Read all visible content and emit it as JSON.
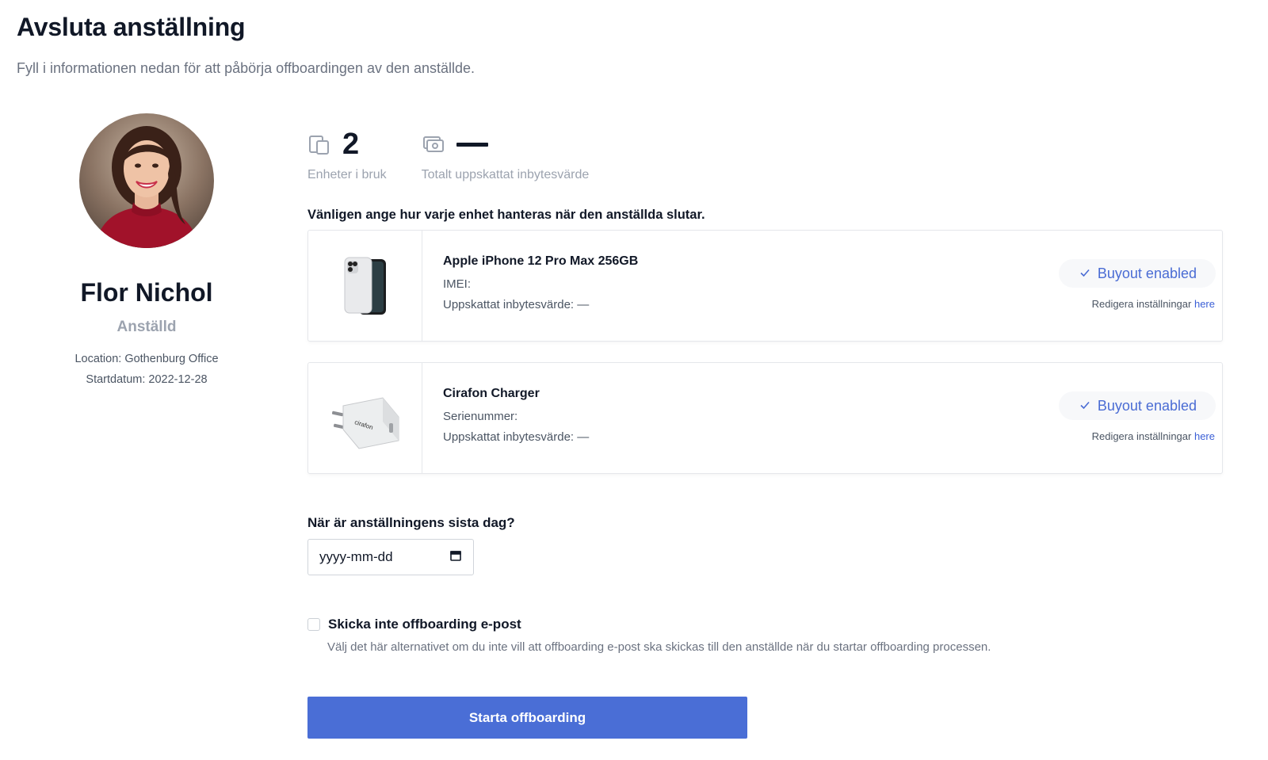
{
  "header": {
    "title": "Avsluta anställning",
    "subtitle": "Fyll i informationen nedan för att påbörja offboardingen av den anställde."
  },
  "employee": {
    "name": "Flor Nichol",
    "role": "Anställd",
    "location": "Location: Gothenburg Office",
    "start_date": "Startdatum: 2022-12-28",
    "avatar": "avatar-photo"
  },
  "stats": {
    "devices_in_use": {
      "value": "2",
      "label": "Enheter i bruk",
      "icon": "devices-icon"
    },
    "trade_in_value": {
      "value": "—",
      "label": "Totalt uppskattat inbytesvärde",
      "icon": "cash-icon"
    }
  },
  "devices_heading": "Vänligen ange hur varje enhet hanteras när den anställda slutar.",
  "devices": [
    {
      "name": "Apple iPhone 12 Pro Max 256GB",
      "id_line": "IMEI:",
      "value_line": "Uppskattat inbytesvärde: —",
      "badge": "Buyout enabled",
      "edit_text": "Redigera inställningar",
      "edit_link": "here",
      "image": "iphone-image"
    },
    {
      "name": "Cirafon Charger",
      "id_line": "Serienummer:",
      "value_line": "Uppskattat inbytesvärde: —",
      "badge": "Buyout enabled",
      "edit_text": "Redigera inställningar",
      "edit_link": "here",
      "image": "charger-image"
    }
  ],
  "last_day": {
    "label": "När är anställningens sista dag?",
    "placeholder": "yyyy-mm-dd"
  },
  "email_option": {
    "label": "Skicka inte offboarding e-post",
    "help": "Välj det här alternativet om du inte vill att offboarding e-post ska skickas till den anställde när du startar offboarding processen.",
    "checked": false
  },
  "submit_label": "Starta offboarding",
  "colors": {
    "accent": "#4a6ed6",
    "badge_text": "#4a6cd4",
    "muted": "#9ca3af"
  }
}
